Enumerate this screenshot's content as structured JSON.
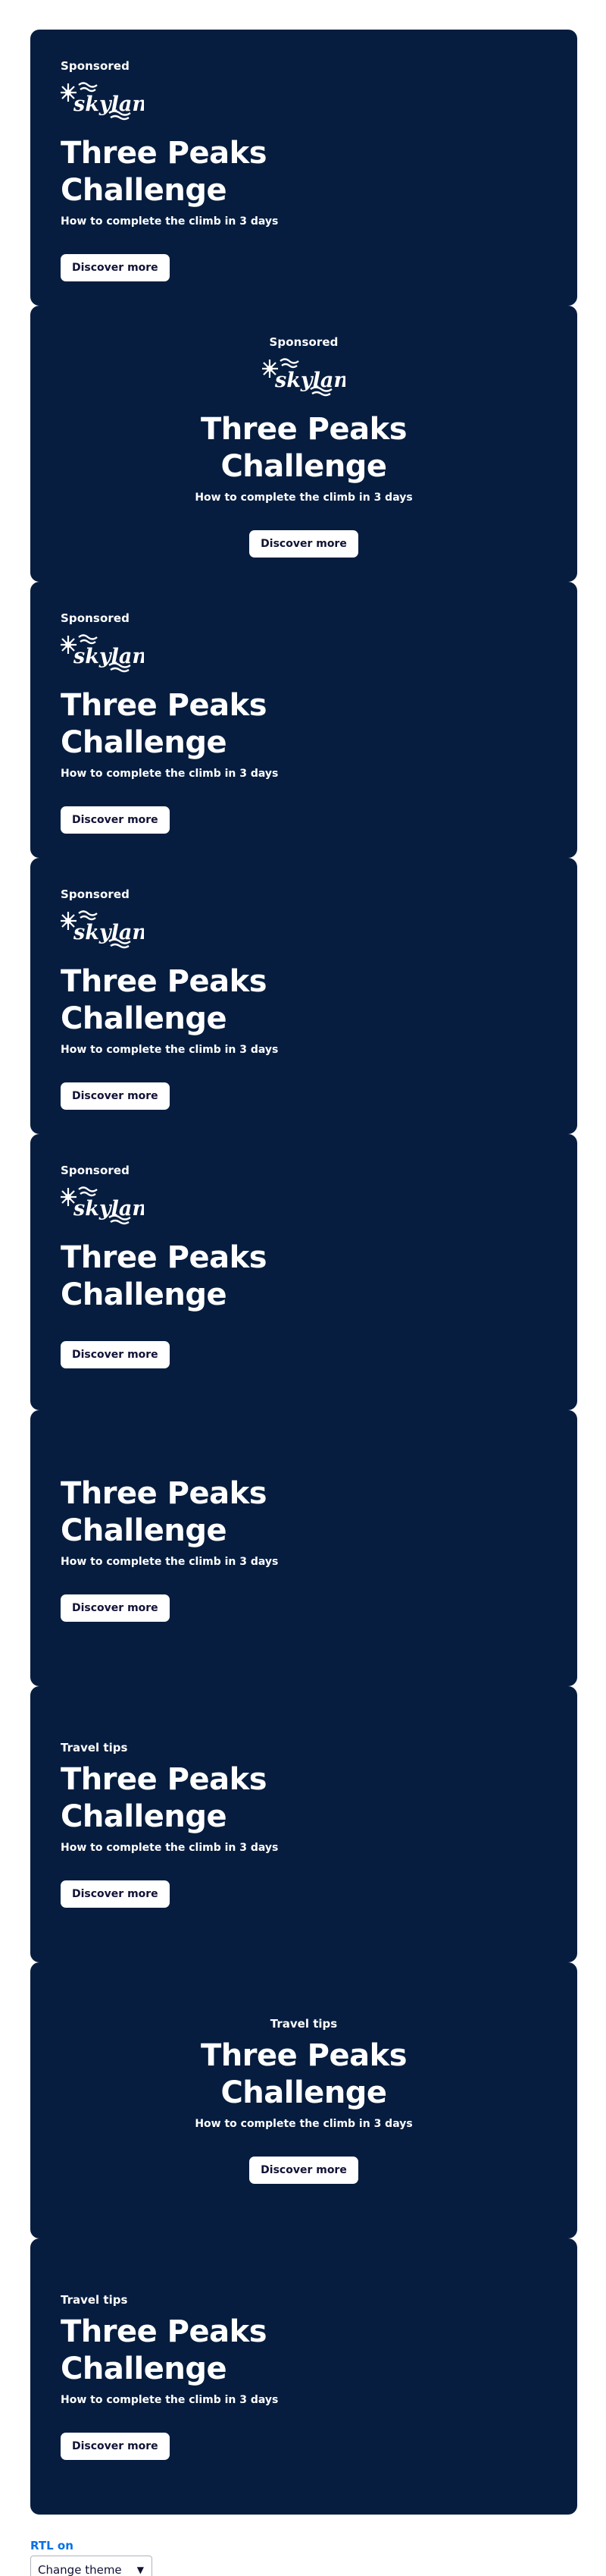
{
  "cards": [
    {
      "sponsored": "Sponsored",
      "logo": "Skyland",
      "title_line1": "Three Peaks",
      "title_line2": "Challenge",
      "description": "How to complete the climb in 3 days",
      "button": "Discover more"
    },
    {
      "sponsored": "Sponsored",
      "logo": "Skyland",
      "title_line1": "Three Peaks",
      "title_line2": "Challenge",
      "description": "How to complete the climb in 3 days",
      "button": "Discover more"
    },
    {
      "sponsored": "Sponsored",
      "logo": "Skyland",
      "title_line1": "Three Peaks",
      "title_line2": "Challenge",
      "description": "How to complete the climb in 3 days",
      "button": "Discover more"
    },
    {
      "sponsored": "Sponsored",
      "logo": "Skyland",
      "title_line1": "Three Peaks",
      "title_line2": "Challenge",
      "description": "How to complete the climb in 3 days",
      "button": "Discover more"
    },
    {
      "sponsored": "Sponsored",
      "logo": "Skyland",
      "title_line1": "Three Peaks",
      "title_line2": "Challenge",
      "button": "Discover more"
    },
    {
      "title_line1": "Three Peaks",
      "title_line2": "Challenge",
      "description": "How to complete the climb in 3 days",
      "button": "Discover more"
    },
    {
      "label": "Travel tips",
      "title_line1": "Three Peaks",
      "title_line2": "Challenge",
      "description": "How to complete the climb in 3 days",
      "button": "Discover more"
    },
    {
      "label": "Travel tips",
      "title_line1": "Three Peaks",
      "title_line2": "Challenge",
      "description": "How to complete the climb in 3 days",
      "button": "Discover more"
    },
    {
      "label": "Travel tips",
      "title_line1": "Three Peaks",
      "title_line2": "Challenge",
      "description": "How to complete the climb in 3 days",
      "button": "Discover more"
    }
  ],
  "footer": {
    "rtl_link": "RTL on",
    "theme_select": "Change theme"
  },
  "colors": {
    "card_background": "#061d3f",
    "link": "#0770e3",
    "button_text": "#111236"
  },
  "icons": {
    "logo": "skyland-logo",
    "select": "chevron-down-icon"
  }
}
